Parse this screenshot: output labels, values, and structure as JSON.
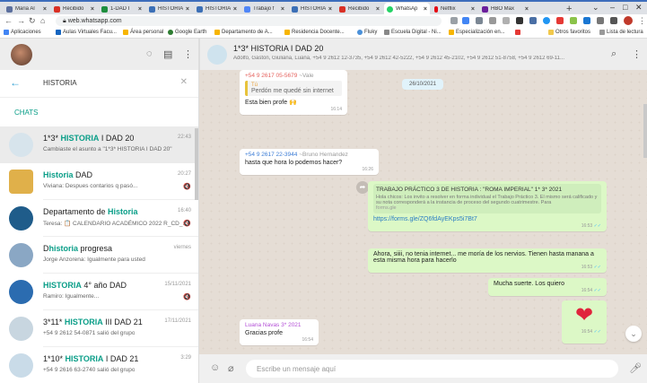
{
  "browser": {
    "tabs": [
      {
        "label": "Maria Al",
        "color": "#5b6f9e"
      },
      {
        "label": "Recibido",
        "color": "#d93025"
      },
      {
        "label": "1-DAD I",
        "color": "#1e8e3e"
      },
      {
        "label": "HISTORIA",
        "color": "#3b6fb6"
      },
      {
        "label": "HISTORIA",
        "color": "#3b6fb6"
      },
      {
        "label": "Trabajo f",
        "color": "#4f86f7"
      },
      {
        "label": "HISTORIA",
        "color": "#3b6fb6"
      },
      {
        "label": "Recibido",
        "color": "#d93025"
      },
      {
        "label": "WhatsAp",
        "color": "#25d366"
      },
      {
        "label": "Netflix",
        "color": "#e50914"
      },
      {
        "label": "HBO Max",
        "color": "#6b1f9c"
      }
    ],
    "url": "web.whatsapp.com",
    "bookmarks": [
      "Aplicaciones",
      "Aulas Virtuales Facu...",
      "Área personal",
      "Google Earth",
      "Departamento de A...",
      "Residencia Docente...",
      "Fluky",
      "Escuela Digital - Ni...",
      "Especialización en...",
      "Otros favoritos",
      "Lista de lectura"
    ]
  },
  "search": {
    "query": "HISTORIA"
  },
  "section_label": "CHATS",
  "chats": [
    {
      "prefix": "1*3* ",
      "highlight": "HISTORIA",
      "suffix": " I DAD 20",
      "time": "22:43",
      "preview": "Cambiaste el asunto a \"1*3* HISTORIA I DAD 20\"",
      "muted": "",
      "avatar": "#d7e4ec"
    },
    {
      "prefix": "",
      "highlight": "Historia",
      "suffix": " DAD",
      "time": "20:27",
      "preview": "Viviana: Despues contarios q pasó...",
      "muted": "🔇",
      "avatar": "#e0b04a"
    },
    {
      "prefix": "Departamento de ",
      "highlight": "Historia",
      "suffix": "",
      "time": "16:40",
      "preview": "Teresa: 📋 CALENDARIO ACADÉMICO 2022 R_CD_...",
      "muted": "🔇",
      "avatar": "#1f5c8a"
    },
    {
      "prefix": "D",
      "highlight": "historia",
      "suffix": " progresa",
      "time": "viernes",
      "preview": "Jorge Anzorena: Igualmente para usted",
      "muted": "",
      "avatar": "#8aa7c4"
    },
    {
      "prefix": "",
      "highlight": "HISTORIA",
      "suffix": " 4° año DAD",
      "time": "15/11/2021",
      "preview": "Ramiro: Igualmente...",
      "muted": "🔇",
      "avatar": "#2b6cb0"
    },
    {
      "prefix": "3*11* ",
      "highlight": "HISTORIA",
      "suffix": " III DAD 21",
      "time": "17/11/2021",
      "preview": "+54 9 2612 54-0871 salió del grupo",
      "muted": "",
      "avatar": "#c8d6e0"
    },
    {
      "prefix": "1*10* ",
      "highlight": "HISTORIA",
      "suffix": " I DAD 21",
      "time": "3:29",
      "preview": "+54 9 2616 63-2740 salió del grupo",
      "muted": "",
      "avatar": "#c9dbe8"
    }
  ],
  "conversation": {
    "title": "1*3* HISTORIA I DAD 20",
    "members": "Adolfo, Gaston, Giuliana, Luana, +54 9 2612 12-3735, +54 9 2612 42-5222, +54 9 2612 45-2102, +54 9 2612 51-8758, +54 9 2612 69-11...",
    "date_chip": "26/10/2021",
    "messages": {
      "m1": {
        "sender": "+54 9 2617 05-5679",
        "sender_name": "~Vale",
        "quote_author": "Tú",
        "quote_text": "Perdón me quedé sin internet",
        "text": "Esta bien profe 🙌",
        "time": "16:14"
      },
      "m2": {
        "sender": "+54 9 2617 22-3944",
        "sender_name": "~Bruno Hernandez",
        "text": "hasta que hora lo podemos hacer?",
        "time": "16:26"
      },
      "m3": {
        "title": "TRABAJO PRÁCTICO 3 DE HISTORIA : \"ROMA IMPERIAL\" 1* 3* 2021",
        "desc": "Hola chicos: Los invito a resolver en forma individual el Trabajo Práctico 3. El mismo será calificado y su nota corresponderá a la instancia de proceso del segundo cuatrimestre. Para",
        "domain": "forms.gle",
        "link": "https://forms.gle/ZQ6fdAyEKps5i7Bt7",
        "time": "16:53"
      },
      "m4": {
        "text": "Ahora, siiii, no tenia internet... me moría de los nervios. Tienen hasta manana a esta misma hora para hacerlo",
        "time": "16:53"
      },
      "m5": {
        "text": "Mucha suerte. Los quiero",
        "time": "16:54"
      },
      "m6": {
        "text": "❤",
        "time": "16:54"
      },
      "m7": {
        "sender_name": "Luana Navas",
        "sender_date": "3* 2021",
        "text": "Gracias profe",
        "time": "16:54"
      }
    }
  },
  "composer": {
    "placeholder": "Escribe un mensaje aquí"
  },
  "colors": {
    "accent": "#0a9e88",
    "outgoing": "#dcf8c6",
    "incoming": "#ffffff",
    "heart": "#e0243c"
  }
}
